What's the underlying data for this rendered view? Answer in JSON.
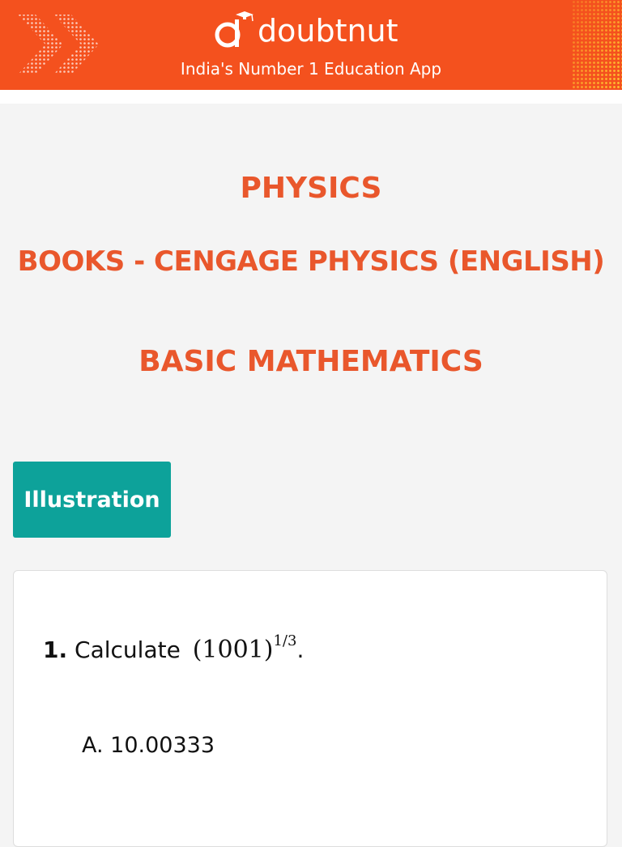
{
  "header": {
    "brand_name": "doubtnut",
    "tagline": "India's Number 1 Education App",
    "colors": {
      "background": "#f4511e",
      "text": "#ffffff"
    },
    "icons": [
      "chevrons-decoration-icon",
      "doubtnut-logo-icon",
      "dots-decoration-icon"
    ]
  },
  "headings": {
    "subject": "PHYSICS",
    "book": "BOOKS - CENGAGE PHYSICS (ENGLISH)",
    "chapter": "BASIC MATHEMATICS",
    "color": "#e9572c"
  },
  "tab": {
    "label": "Illustration",
    "color": "#0da29a"
  },
  "question": {
    "number": "1.",
    "text": "Calculate",
    "math_base": "(1001)",
    "math_exponent": "1/3",
    "punctuation": ".",
    "options": [
      "A. 10.00333"
    ]
  }
}
